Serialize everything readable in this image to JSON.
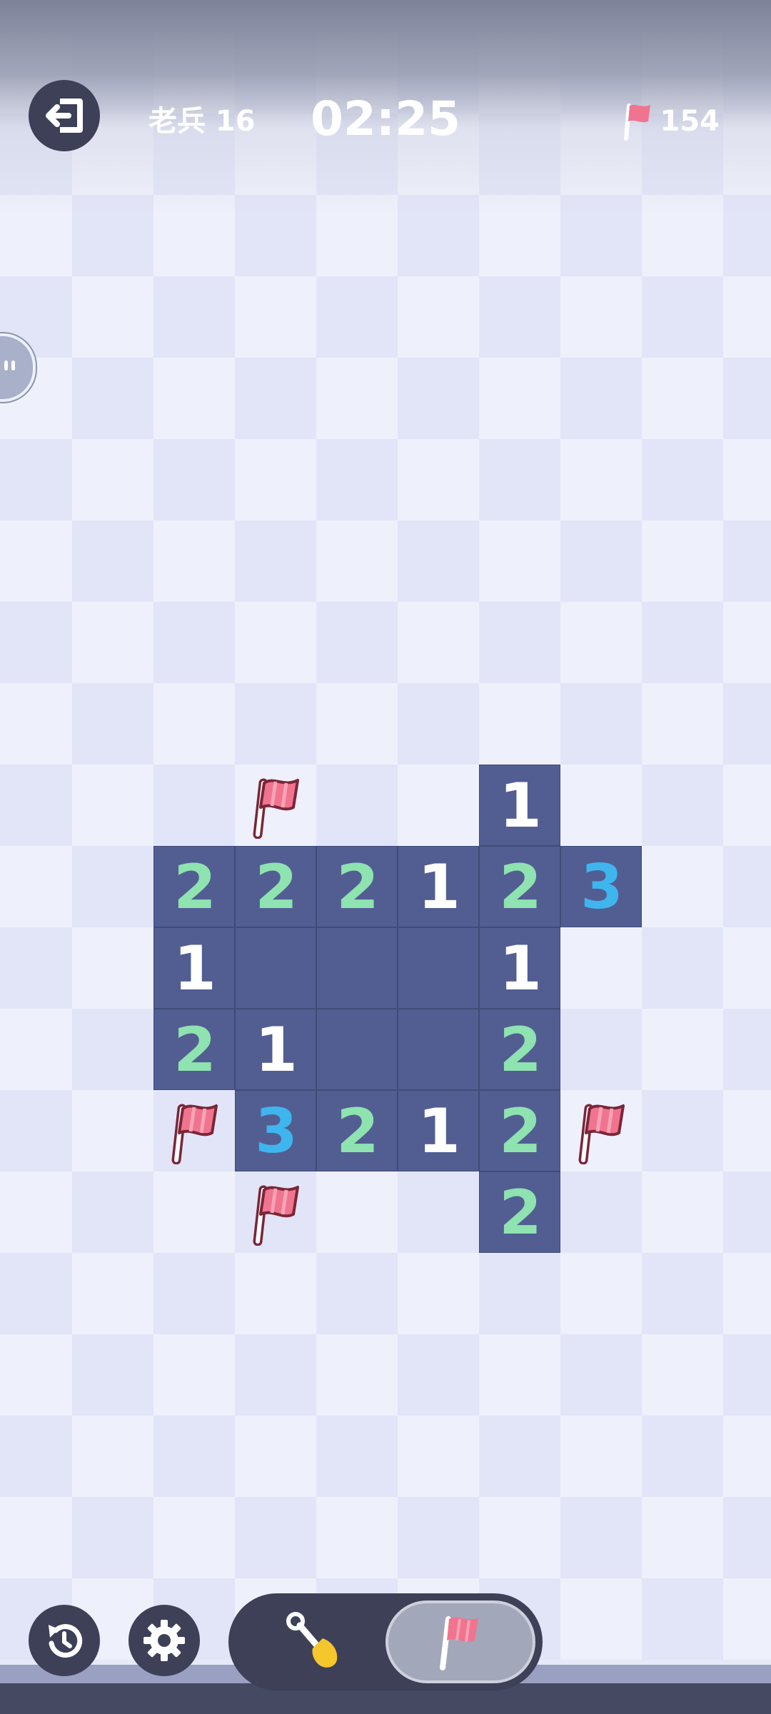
{
  "header": {
    "level_label": "老兵 16",
    "timer": "02:25",
    "flags_remaining": "154"
  },
  "icons": {
    "exit": "exit-arrow-icon",
    "flag": "flag-icon",
    "restart": "restart-icon",
    "settings": "gear-icon",
    "dig": "shovel-icon",
    "chat": "chat-bubble-icon"
  },
  "colors": {
    "cell_light": "#eef0fb",
    "cell_dark": "#e1e5f7",
    "revealed": "#525e92",
    "num_1": "#ffffff",
    "num_2": "#8ee3b0",
    "num_3": "#3fb5ee",
    "flag": "#f0748f"
  },
  "board": {
    "cols": 10,
    "rows": 20,
    "revealed": [
      {
        "row": 9,
        "col": 6,
        "value": "1"
      },
      {
        "row": 10,
        "col": 2,
        "value": "2"
      },
      {
        "row": 10,
        "col": 3,
        "value": "2"
      },
      {
        "row": 10,
        "col": 4,
        "value": "2"
      },
      {
        "row": 10,
        "col": 5,
        "value": "1"
      },
      {
        "row": 10,
        "col": 6,
        "value": "2"
      },
      {
        "row": 10,
        "col": 7,
        "value": "3"
      },
      {
        "row": 11,
        "col": 2,
        "value": "1"
      },
      {
        "row": 11,
        "col": 3,
        "value": ""
      },
      {
        "row": 11,
        "col": 4,
        "value": ""
      },
      {
        "row": 11,
        "col": 5,
        "value": ""
      },
      {
        "row": 11,
        "col": 6,
        "value": "1"
      },
      {
        "row": 12,
        "col": 2,
        "value": "2"
      },
      {
        "row": 12,
        "col": 3,
        "value": "1"
      },
      {
        "row": 12,
        "col": 4,
        "value": ""
      },
      {
        "row": 12,
        "col": 5,
        "value": ""
      },
      {
        "row": 12,
        "col": 6,
        "value": "2"
      },
      {
        "row": 13,
        "col": 3,
        "value": "3"
      },
      {
        "row": 13,
        "col": 4,
        "value": "2"
      },
      {
        "row": 13,
        "col": 5,
        "value": "1"
      },
      {
        "row": 13,
        "col": 6,
        "value": "2"
      },
      {
        "row": 14,
        "col": 6,
        "value": "2"
      }
    ],
    "flags": [
      {
        "row": 9,
        "col": 3
      },
      {
        "row": 13,
        "col": 2
      },
      {
        "row": 13,
        "col": 7
      },
      {
        "row": 14,
        "col": 3
      }
    ]
  },
  "controls": {
    "mode_selected": "flag"
  }
}
